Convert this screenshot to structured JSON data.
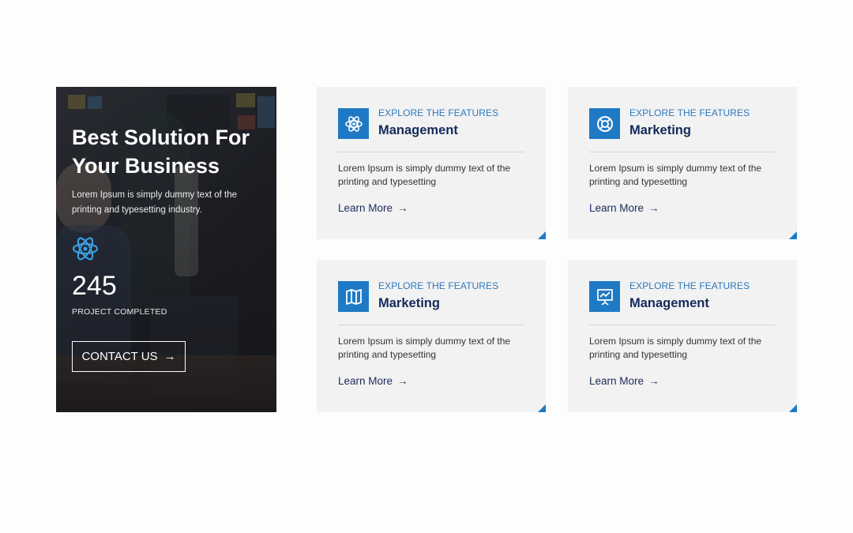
{
  "hero": {
    "title": "Best Solution For Your Business",
    "description": "Lorem Ipsum is simply dummy text of the printing and typesetting industry.",
    "count": "245",
    "count_label": "PROJECT COMPLETED",
    "cta_label": "CONTACT US",
    "cta_arrow": "→",
    "icon": "atom-icon"
  },
  "cards": [
    {
      "kicker": "EXPLORE THE FEATURES",
      "title": "Management",
      "description": "Lorem Ipsum is simply dummy text of the printing and typesetting",
      "link_label": "Learn More",
      "arrow": "→",
      "icon": "atom-icon"
    },
    {
      "kicker": "EXPLORE THE FEATURES",
      "title": "Marketing",
      "description": "Lorem Ipsum is simply dummy text of the printing and typesetting",
      "link_label": "Learn More",
      "arrow": "→",
      "icon": "lifebuoy-icon"
    },
    {
      "kicker": "EXPLORE THE FEATURES",
      "title": "Marketing",
      "description": "Lorem Ipsum is simply dummy text of the printing and typesetting",
      "link_label": "Learn More",
      "arrow": "→",
      "icon": "map-icon"
    },
    {
      "kicker": "EXPLORE THE FEATURES",
      "title": "Management",
      "description": "Lorem Ipsum is simply dummy text of the printing and typesetting",
      "link_label": "Learn More",
      "arrow": "→",
      "icon": "presentation-chart-icon"
    }
  ],
  "colors": {
    "accent": "#1e7ac5",
    "kicker": "#2b78bf",
    "heading": "#152a5a",
    "card_bg": "#f2f2f2"
  }
}
